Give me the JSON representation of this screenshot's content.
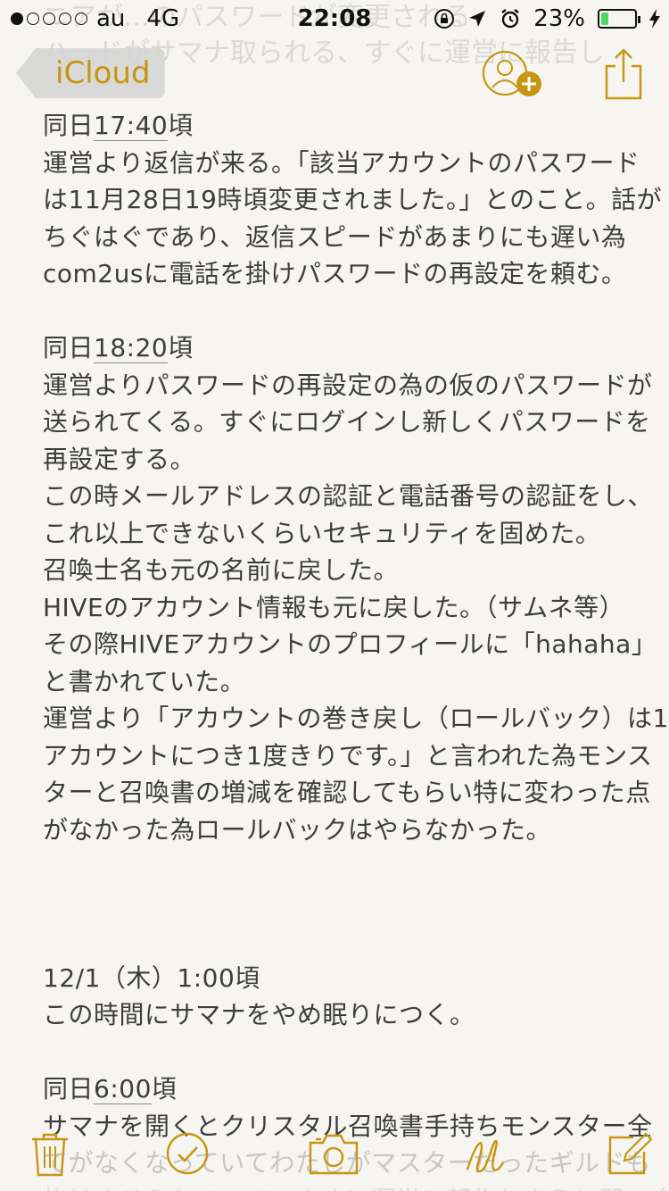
{
  "status": {
    "carrier": "au",
    "network": "4G",
    "time": "22:08",
    "battery": "23%",
    "battery_level": 0.23,
    "signal_bars_filled": 1,
    "signal_bars_total": 5
  },
  "nav": {
    "back_label": "iCloud",
    "accent_color": "#c7960f"
  },
  "faded_lines": [
    "ニアが…のパスワードが変更される",
    "ハードがサマナ取られる、すぐに運営に報告し"
  ],
  "note": {
    "section1": {
      "day": "同日",
      "time": "17:40",
      "suffix": "頃",
      "lines": [
        "運営より返信が来る。「該当アカウントのパスワード",
        "は11月28日19時頃変更されました。」とのこと。話が",
        "ちぐはぐであり、返信スピードがあまりにも遅い為",
        "com2usに電話を掛けパスワードの再設定を頼む。"
      ]
    },
    "section2": {
      "day": "同日",
      "time": "18:20",
      "suffix": "頃",
      "lines": [
        "運営よりパスワードの再設定の為の仮のパスワードが",
        "送られてくる。すぐにログインし新しくパスワードを",
        "再設定する。",
        "この時メールアドレスの認証と電話番号の認証をし、",
        "これ以上できないくらいセキュリティを固めた。",
        "召喚士名も元の名前に戻した。",
        "HIVEのアカウント情報も元に戻した。（サムネ等）",
        "その際HIVEアカウントのプロフィールに「hahaha」",
        "と書かれていた。",
        "運営より「アカウントの巻き戻し（ロールバック）は1",
        "アカウントにつき1度きりです。」と言われた為モンス",
        "ターと召喚書の増減を確認してもらい特に変わった点",
        "がなかった為ロールバックはやらなかった。"
      ]
    },
    "section3": {
      "heading": "12/1（木）1:00頃",
      "lines": [
        "この時間にサマナをやめ眠りにつく。"
      ]
    },
    "section4": {
      "day": "同日",
      "time": "6:00",
      "suffix": "頃",
      "lines": [
        "サマナを開くとクリスタル召喚書手持ちモンスター全",
        "てがなくなっていてわたしがマスターだったギルドも",
        "抜けさせられていて、すぐに運営に報告しようと問い合わせ"
      ]
    }
  },
  "toolbar": {
    "icons": [
      "trash-icon",
      "checklist-icon",
      "camera-icon",
      "sketch-icon",
      "compose-icon"
    ]
  }
}
